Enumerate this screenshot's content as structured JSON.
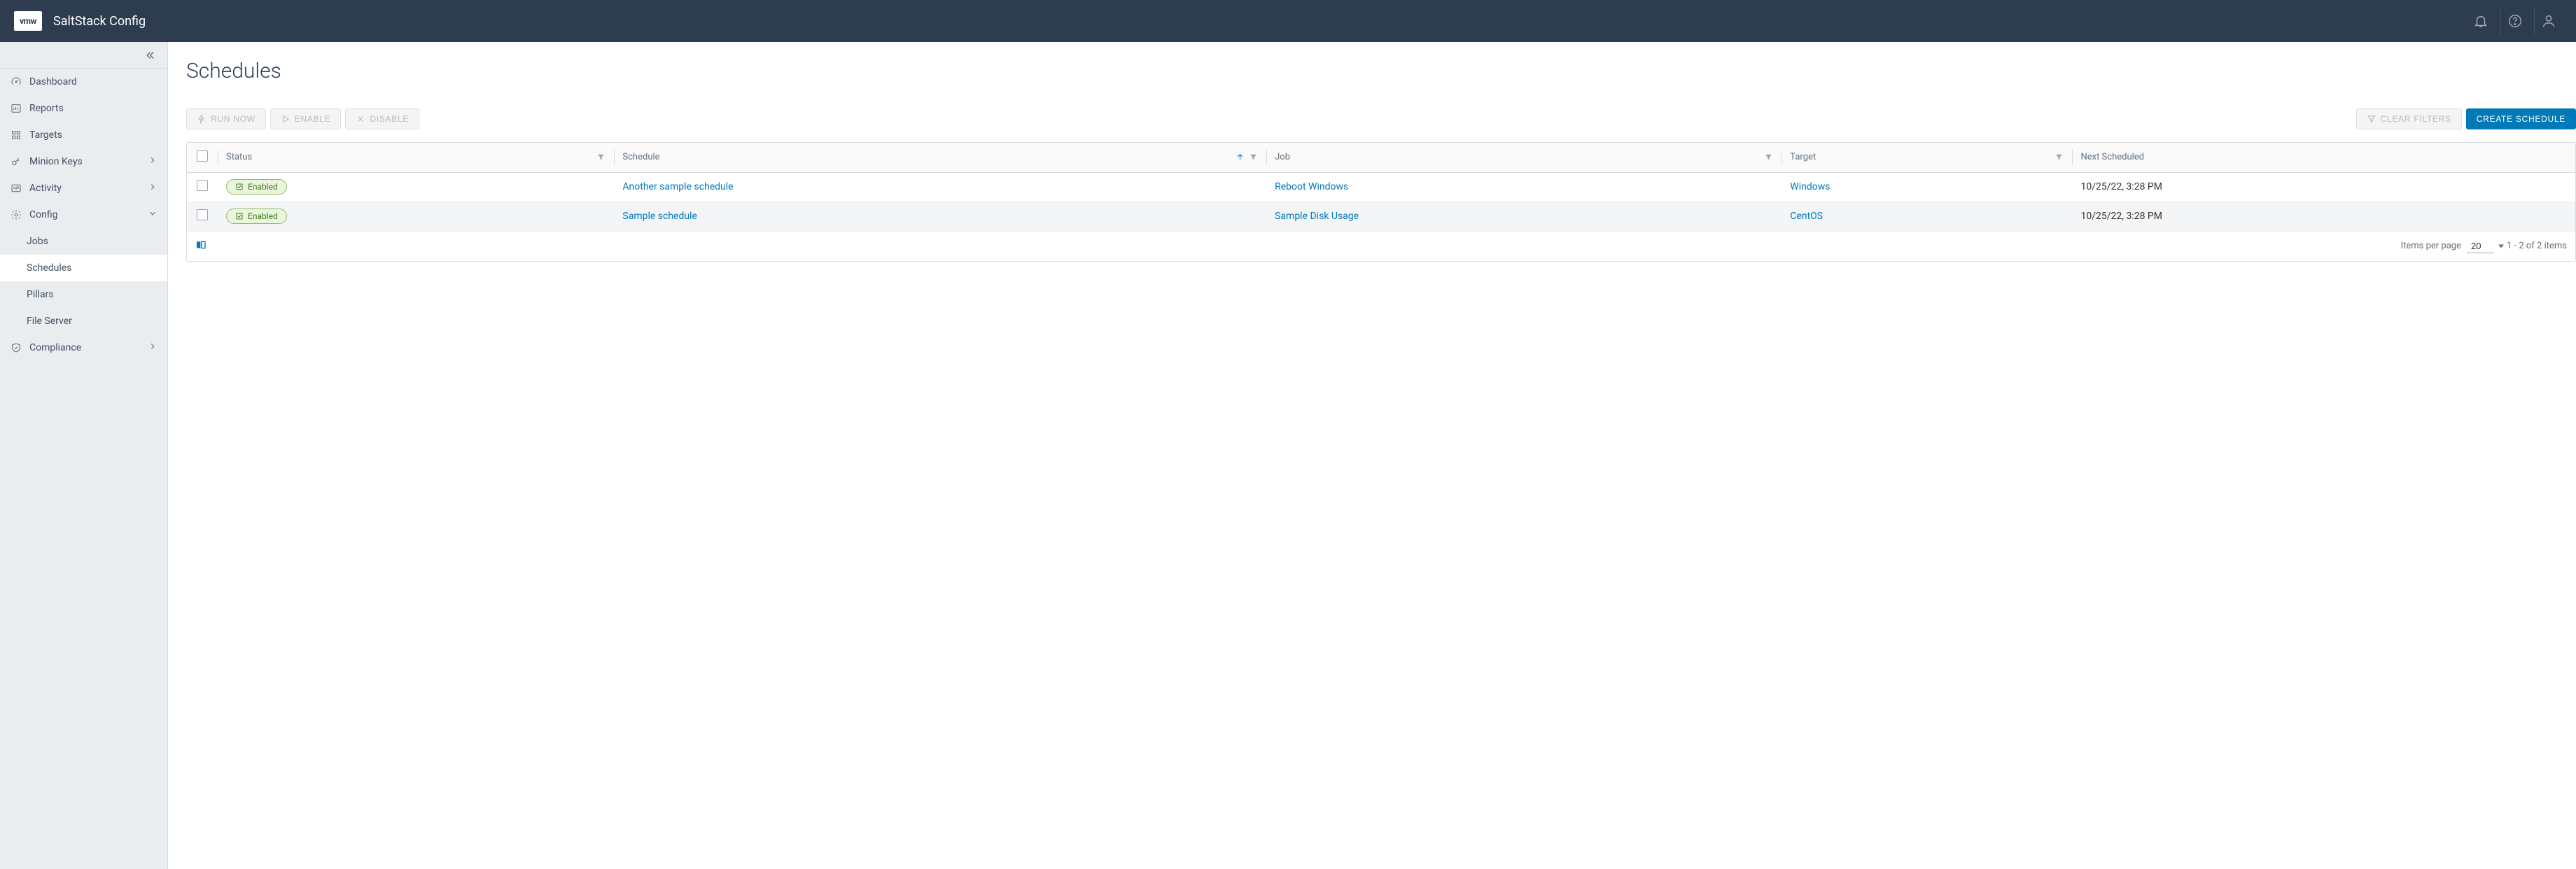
{
  "header": {
    "logo_text": "vmw",
    "app_title": "SaltStack Config"
  },
  "sidebar": {
    "dashboard": "Dashboard",
    "reports": "Reports",
    "targets": "Targets",
    "minion_keys": "Minion Keys",
    "activity": "Activity",
    "config": "Config",
    "config_children": {
      "jobs": "Jobs",
      "schedules": "Schedules",
      "pillars": "Pillars",
      "file_server": "File Server"
    },
    "compliance": "Compliance"
  },
  "page": {
    "title": "Schedules",
    "run_now": "Run Now",
    "enable": "Enable",
    "disable": "Disable",
    "clear_filters": "Clear Filters",
    "create_schedule": "Create Schedule"
  },
  "table": {
    "columns": {
      "status": "Status",
      "schedule": "Schedule",
      "job": "Job",
      "target": "Target",
      "next_scheduled": "Next Scheduled"
    },
    "rows": [
      {
        "status": "Enabled",
        "schedule": "Another sample schedule",
        "job": "Reboot Windows",
        "target": "Windows",
        "next_scheduled": "10/25/22, 3:28 PM"
      },
      {
        "status": "Enabled",
        "schedule": "Sample schedule",
        "job": "Sample Disk Usage",
        "target": "CentOS",
        "next_scheduled": "10/25/22, 3:28 PM"
      }
    ],
    "footer": {
      "items_per_page_label": "Items per page",
      "items_per_page_value": "20",
      "range_text": "1 - 2 of 2 items"
    }
  }
}
